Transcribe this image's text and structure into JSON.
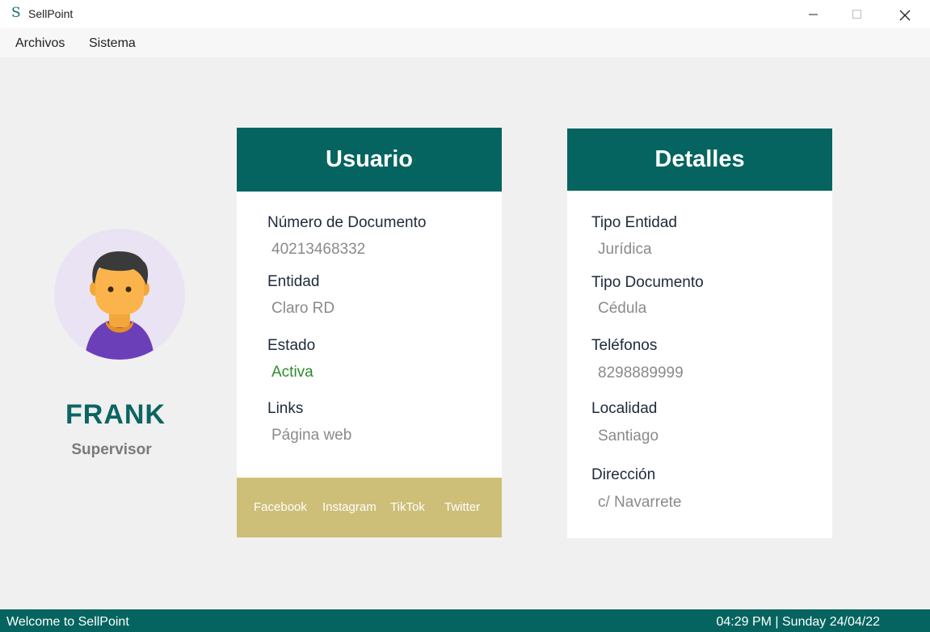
{
  "window": {
    "app_icon": "S",
    "title": "SellPoint"
  },
  "menu": {
    "items": [
      "Archivos",
      "Sistema"
    ]
  },
  "profile": {
    "name": "FRANK",
    "role": "Supervisor"
  },
  "usuario_card": {
    "header": "Usuario",
    "fields": [
      {
        "label": "Número de Documento",
        "value": "40213468332"
      },
      {
        "label": "Entidad",
        "value": "Claro RD"
      },
      {
        "label": "Estado",
        "value": "Activa"
      },
      {
        "label": "Links",
        "value": "Página web"
      }
    ],
    "social_links": [
      "Facebook",
      "Instagram",
      "TikTok",
      "Twitter"
    ]
  },
  "detalles_card": {
    "header": "Detalles",
    "fields": [
      {
        "label": "Tipo Entidad",
        "value": "Jurídica"
      },
      {
        "label": "Tipo Documento",
        "value": "Cédula"
      },
      {
        "label": "Teléfonos",
        "value": "8298889999"
      },
      {
        "label": "Localidad",
        "value": "Santiago"
      },
      {
        "label": "Dirección",
        "value": "c/ Navarrete"
      }
    ]
  },
  "statusbar": {
    "welcome": "Welcome to SellPoint",
    "datetime": "04:29 PM | Sunday 24/04/22"
  },
  "colors": {
    "primary": "#05645f",
    "accent_gold": "#cdbf78",
    "status_active": "#2e8b2e",
    "avatar_bg": "#e9e3f4"
  },
  "icons": {
    "app": "sellpoint-logo-icon",
    "minimize": "minimize-icon",
    "maximize": "maximize-icon",
    "close": "close-icon",
    "avatar": "user-avatar-illustration"
  }
}
